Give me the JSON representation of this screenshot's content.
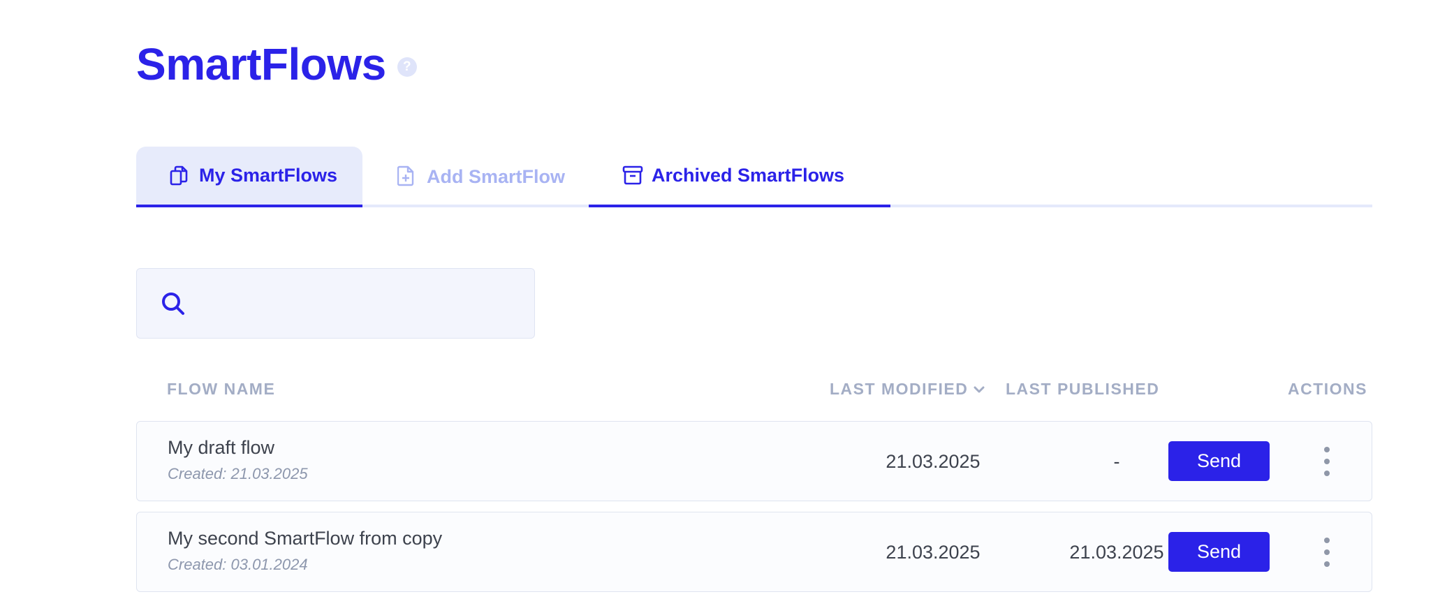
{
  "header": {
    "title": "SmartFlows",
    "help_glyph": "?"
  },
  "tabs": [
    {
      "label": "My SmartFlows",
      "icon": "copy-documents-icon",
      "state": "active"
    },
    {
      "label": "Add SmartFlow",
      "icon": "file-plus-icon",
      "state": "disabled"
    },
    {
      "label": "Archived SmartFlows",
      "icon": "archive-box-icon",
      "state": "underlined"
    }
  ],
  "search": {
    "icon": "search-icon",
    "value": "",
    "placeholder": ""
  },
  "table": {
    "columns": {
      "flow_name": "FLOW NAME",
      "last_modified": "LAST MODIFIED",
      "last_published": "LAST PUBLISHED",
      "actions": "ACTIONS"
    },
    "sort": {
      "column": "last_modified",
      "icon": "chevron-down-icon"
    },
    "rows": [
      {
        "name": "My draft flow",
        "created": "Created: 21.03.2025",
        "last_modified": "21.03.2025",
        "last_published": "-",
        "action_label": "Send"
      },
      {
        "name": "My second SmartFlow from copy",
        "created": "Created: 03.01.2024",
        "last_modified": "21.03.2025",
        "last_published": "21.03.2025",
        "action_label": "Send"
      }
    ]
  },
  "colors": {
    "accent": "#2b22e8",
    "accent_light": "#a8b3f3",
    "header_text": "#a3adc5"
  }
}
